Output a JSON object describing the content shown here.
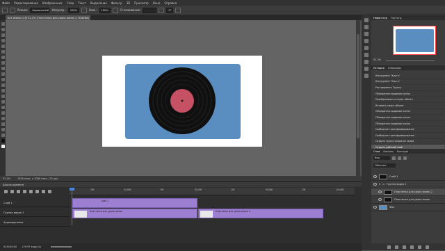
{
  "menu": [
    "Файл",
    "Редактирование",
    "Изображение",
    "Слои",
    "Текст",
    "Выделение",
    "Фильтр",
    "3D",
    "Просмотр",
    "Окно",
    "Справка"
  ],
  "options": {
    "mode_label": "Режим:",
    "mode_value": "Нормальный",
    "opacity_label": "Непрозр.:",
    "opacity_value": "100%",
    "flow_label": "Наж.:",
    "flow_value": "100%",
    "smoothing_label": "Сглаживание:",
    "angle_value": "0°"
  },
  "document": {
    "tab_title": "Без имени-1 @ 51,2% (Пластинка для урока вопик 2, RGB/8#)",
    "zoom": "51,2%",
    "size": "1920 пикс. x 1080 пикс. (72 ppi)"
  },
  "timeline": {
    "title": "Шкала времени",
    "ruler": [
      "15f",
      "01:00f",
      "15f",
      "02:00f",
      "15f",
      "03:00f",
      "15f",
      "04:00f"
    ],
    "tracks": [
      {
        "name": "Слой 1"
      },
      {
        "name": "Группа видео 1"
      },
      {
        "name": "Аудиодорожка"
      }
    ],
    "clips": {
      "layer1": "Слой 1",
      "video_a": "Пластинка для урока вопик",
      "video_b": "Пластинка для урока вопик 2"
    },
    "time": "0;00;00;00",
    "fps": "(29,97 кадр./с)"
  },
  "right_panel": {
    "nav_tabs": [
      "Навигатор",
      "Гистогр."
    ],
    "nav_zoom": "51,2%",
    "history_tabs": [
      "История",
      "Операции"
    ],
    "history": [
      "Инструмент \"Кисть\"",
      "Инструмент \"Кисть\"",
      "Растрировать Группу",
      "Объединить видимые копии",
      "Преобразовать в смарт-объект",
      "Вставить смарт-объект",
      "Объединить видимые копии",
      "Объединить видимые копии",
      "Объединить видимые копии",
      "Свободное трансформирование",
      "Свободное трансформирование",
      "Создать группу видео из копии",
      "Создать рабочий слой"
    ],
    "layers_tabs": [
      "Слои",
      "Каналы",
      "Контуры"
    ],
    "layer_filter": "Вид",
    "layer_mode": "Обычные",
    "layers": [
      "Слой 1",
      "Группа видео 1",
      "Пластинка для урока вопик 2",
      "Пластинка для урока вопик",
      "Фон"
    ]
  },
  "colors": {
    "accent_clip": "#9d7fd2",
    "canvas_card": "#5b8ec0",
    "label_red": "#c65064"
  }
}
